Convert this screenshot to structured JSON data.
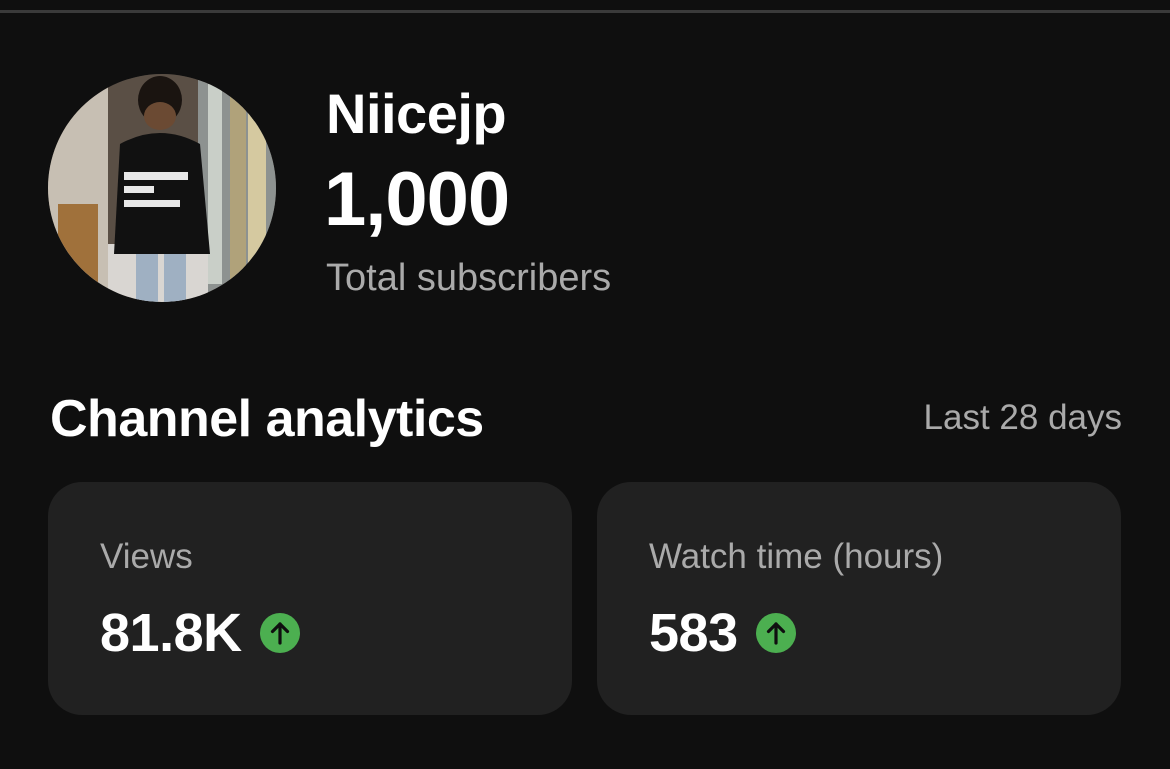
{
  "channel": {
    "name": "Niicejp",
    "subscriber_count": "1,000",
    "subscriber_label": "Total subscribers"
  },
  "analytics": {
    "title": "Channel analytics",
    "period": "Last 28 days",
    "metrics": [
      {
        "label": "Views",
        "value": "81.8K",
        "trend": "up",
        "trend_icon": "arrow-up-circle-icon"
      },
      {
        "label": "Watch time (hours)",
        "value": "583",
        "trend": "up",
        "trend_icon": "arrow-up-circle-icon"
      }
    ]
  },
  "colors": {
    "background": "#0f0f0f",
    "card": "#212121",
    "secondary_text": "#aaaaaa",
    "trend_up": "#4caf50"
  }
}
